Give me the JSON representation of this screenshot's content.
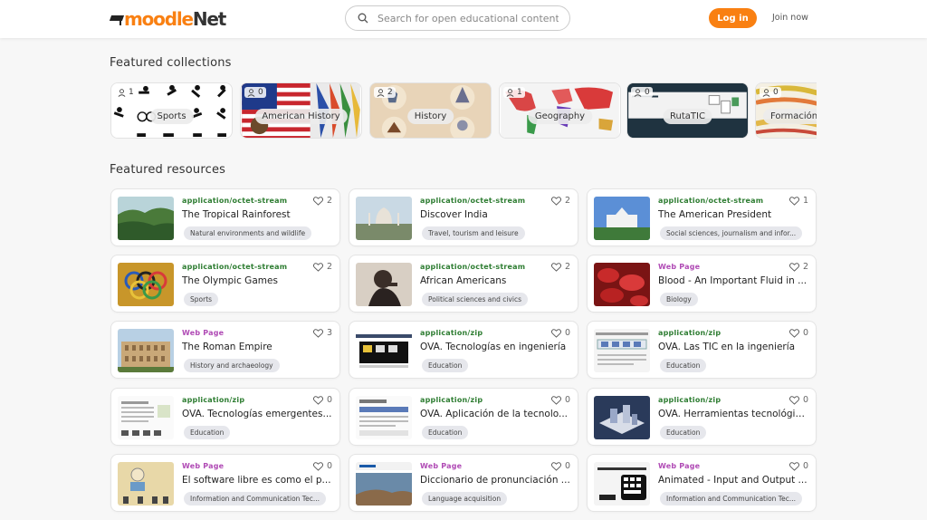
{
  "header": {
    "logo_moodle": "moodle",
    "logo_net": "Net",
    "search_placeholder": "Search for open educational content",
    "login_label": "Log in",
    "join_label": "Join now"
  },
  "sections": {
    "collections_title": "Featured collections",
    "resources_title": "Featured resources"
  },
  "collections": [
    {
      "label": "Sports",
      "count": "1"
    },
    {
      "label": "American History",
      "count": "0"
    },
    {
      "label": "History",
      "count": "2"
    },
    {
      "label": "Geography",
      "count": "1"
    },
    {
      "label": "RutaTIC",
      "count": "0"
    },
    {
      "label": "Formación",
      "count": "0"
    }
  ],
  "resources": [
    {
      "type": "application/octet-stream",
      "title": "The Tropical Rainforest",
      "tag": "Natural environments and wildlife",
      "likes": "2"
    },
    {
      "type": "application/octet-stream",
      "title": "Discover India",
      "tag": "Travel, tourism and leisure",
      "likes": "2"
    },
    {
      "type": "application/octet-stream",
      "title": "The American President",
      "tag": "Social sciences, journalism and infor...",
      "likes": "1"
    },
    {
      "type": "application/octet-stream",
      "title": "The Olympic Games",
      "tag": "Sports",
      "likes": "2"
    },
    {
      "type": "application/octet-stream",
      "title": "African Americans",
      "tag": "Political sciences and civics",
      "likes": "2"
    },
    {
      "type": "Web Page",
      "title": "Blood - An Important Fluid in ...",
      "tag": "Biology",
      "likes": "2"
    },
    {
      "type": "Web Page",
      "title": "The Roman Empire",
      "tag": "History and archaeology",
      "likes": "3"
    },
    {
      "type": "application/zip",
      "title": "OVA. Tecnologías en ingeniería",
      "tag": "Education",
      "likes": "0"
    },
    {
      "type": "application/zip",
      "title": "OVA. Las TIC en la ingeniería",
      "tag": "Education",
      "likes": "0"
    },
    {
      "type": "application/zip",
      "title": "OVA. Tecnologías emergentes...",
      "tag": "Education",
      "likes": "0"
    },
    {
      "type": "application/zip",
      "title": "OVA. Aplicación de la tecnolo...",
      "tag": "Education",
      "likes": "0"
    },
    {
      "type": "application/zip",
      "title": "OVA. Herramientas tecnológic...",
      "tag": "Education",
      "likes": "0"
    },
    {
      "type": "Web Page",
      "title": "El software libre es como el p...",
      "tag": "Information and Communication Tec...",
      "likes": "0"
    },
    {
      "type": "Web Page",
      "title": "Diccionario de pronunciación ...",
      "tag": "Language acquisition",
      "likes": "0"
    },
    {
      "type": "Web Page",
      "title": "Animated - Input and Output ...",
      "tag": "Information and Communication Tec...",
      "likes": "0"
    }
  ],
  "colors": {
    "brand_orange": "#f98012",
    "type_green": "#2e7d32",
    "type_purple": "#b04bb5"
  }
}
